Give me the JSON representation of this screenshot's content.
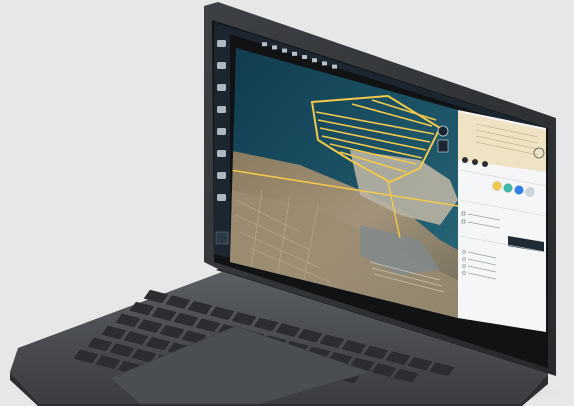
{
  "app": {
    "window_title": "",
    "accent_color": "#f2c94c",
    "panel_color": "#1f2a33",
    "map_water_color": "#1e4f63",
    "flight_path_color": "#f2c94c"
  },
  "toolbar": {
    "icons": [
      "select-icon",
      "polygon-icon",
      "ruler-icon",
      "layers-icon",
      "camera-icon",
      "grid-icon",
      "settings-icon",
      "help-icon"
    ]
  },
  "left_sidebar": {
    "icons": [
      "home-icon",
      "map-icon",
      "plan-icon",
      "drone-icon",
      "photo-icon",
      "model-icon",
      "chart-icon",
      "export-icon"
    ]
  },
  "right_panel": {
    "section_titles": [
      "",
      "",
      ""
    ],
    "swatch_colors": [
      "#f2c94c",
      "#3fb6a8",
      "#2f80ed",
      "#c9d6df"
    ],
    "bottom_buttons": [
      "play-icon",
      "pause-icon",
      "stop-icon",
      "rewind-icon",
      "forward-icon"
    ]
  }
}
